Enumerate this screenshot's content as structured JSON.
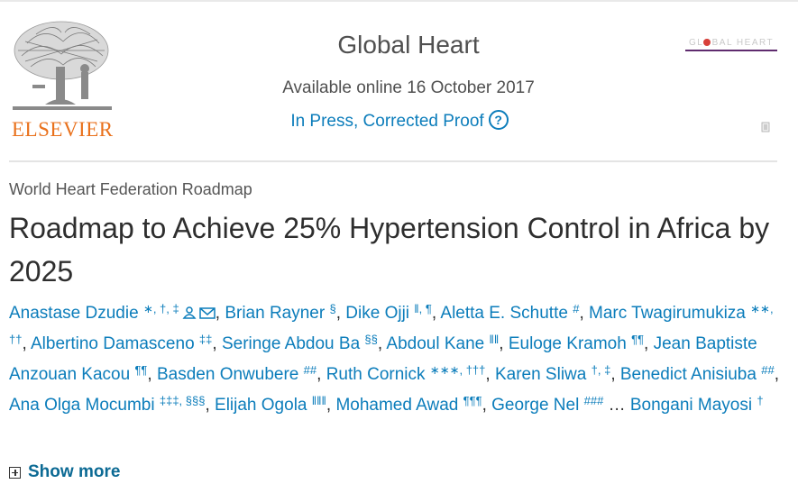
{
  "header": {
    "publisher_name": "ELSEVIER",
    "journal_title": "Global Heart",
    "available_online": "Available online 16 October 2017",
    "status": "In Press, Corrected Proof",
    "help_glyph": "?",
    "cover_text": "GLOBAL HEART"
  },
  "article": {
    "type": "World Heart Federation Roadmap",
    "title": "Roadmap to Achieve 25% Hypertension Control in Africa by 2025"
  },
  "authors": [
    {
      "name": "Anastase Dzudie",
      "sup": "∗, †, ‡"
    },
    {
      "name": "Brian Rayner",
      "sup": "§"
    },
    {
      "name": "Dike Ojji",
      "sup": "ǁ, ¶"
    },
    {
      "name": "Aletta E. Schutte",
      "sup": "#"
    },
    {
      "name": "Marc Twagirumukiza",
      "sup": "∗∗, ††"
    },
    {
      "name": "Albertino Damasceno",
      "sup": "‡‡"
    },
    {
      "name": "Seringe Abdou Ba",
      "sup": "§§"
    },
    {
      "name": "Abdoul Kane",
      "sup": "ǁǁ"
    },
    {
      "name": "Euloge Kramoh",
      "sup": "¶¶"
    },
    {
      "name": "Jean Baptiste Anzouan Kacou",
      "sup": "¶¶"
    },
    {
      "name": "Basden Onwubere",
      "sup": "##"
    },
    {
      "name": "Ruth Cornick",
      "sup": "∗∗∗, †††"
    },
    {
      "name": "Karen Sliwa",
      "sup": "†, ‡"
    },
    {
      "name": "Benedict Anisiuba",
      "sup": "##"
    },
    {
      "name": "Ana Olga Mocumbi",
      "sup": "‡‡‡, §§§"
    },
    {
      "name": "Elijah Ogola",
      "sup": "ǁǁǁ"
    },
    {
      "name": "Mohamed Awad",
      "sup": "¶¶¶"
    },
    {
      "name": "George Nel",
      "sup": "###"
    },
    {
      "name": "Bongani Mayosi",
      "sup": "†"
    }
  ],
  "authors_ellipsis": "…",
  "show_more_label": "Show more",
  "icons": {
    "person": "person-icon",
    "email": "envelope-icon",
    "help": "help-circle-icon",
    "pdf": "pdf-icon",
    "expand": "plus-box-icon"
  },
  "colors": {
    "link": "#0c7dbb",
    "publisher_orange": "#e9711c",
    "show_more": "#0c6a94"
  }
}
